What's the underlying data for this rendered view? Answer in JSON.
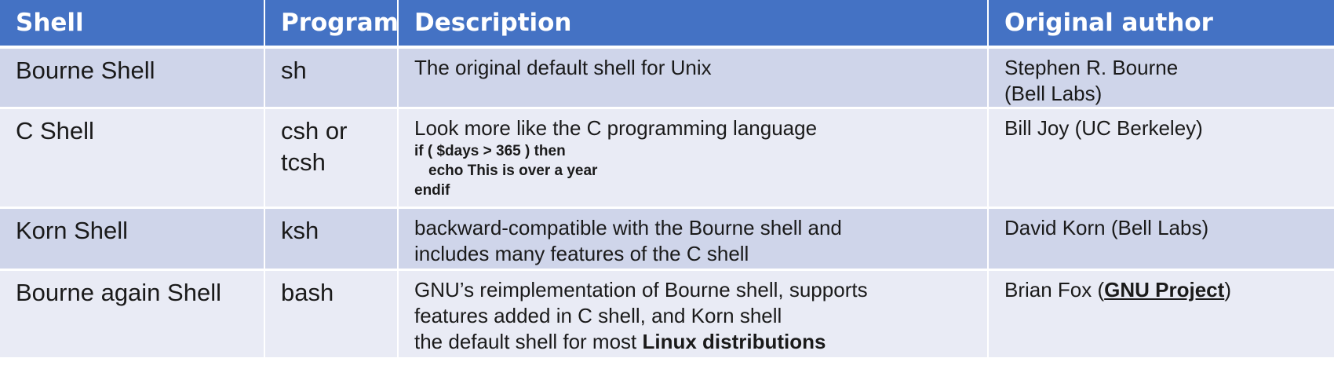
{
  "header": {
    "shell": "Shell",
    "program": "Program",
    "description": "Description",
    "author": "Original author"
  },
  "rows": [
    {
      "shell": "Bourne Shell",
      "program": "sh",
      "description": "The original default shell for Unix",
      "author_line1": "Stephen R. Bourne",
      "author_line2": "(Bell Labs)"
    },
    {
      "shell": "C Shell",
      "program_line1": "csh or",
      "program_line2": "tcsh",
      "description": "Look more like the C programming language",
      "code_line1": "if ( $days > 365 ) then",
      "code_line2": "echo This is over a year",
      "code_line3": "endif",
      "author": "Bill Joy (UC Berkeley)"
    },
    {
      "shell": "Korn Shell",
      "program": "ksh",
      "description_line1": "backward-compatible with the Bourne shell and",
      "description_line2": "includes many features of the C shell",
      "author": "David Korn (Bell Labs)"
    },
    {
      "shell": "Bourne again Shell",
      "program": "bash",
      "description_line1": "GNU’s reimplementation of Bourne shell, supports",
      "description_line2": "features added in C shell, and Korn shell",
      "description_line3_prefix": "the default shell for most ",
      "description_line3_bold": "Linux distributions",
      "author_prefix": "Brian Fox (",
      "author_link": "GNU Project",
      "author_suffix": ")"
    }
  ]
}
